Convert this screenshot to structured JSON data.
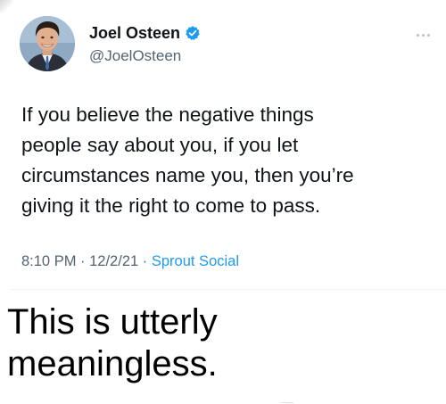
{
  "tweet": {
    "author": {
      "display_name": "Joel Osteen",
      "handle": "@JoelOsteen",
      "verified": true,
      "verified_color": "#1d9bf0"
    },
    "more_icon": "more-horizontal-icon",
    "text": "If you believe the negative things\npeople say about you, if you let\ncircumstances name you, then you’re\ngiving it the right to come to pass.",
    "meta": {
      "time": "8:10 PM",
      "separator_1": " · ",
      "date": "12/2/21",
      "separator_2": " · ",
      "source": "Sprout Social"
    },
    "colors": {
      "text": "#0f1419",
      "secondary": "#536471",
      "link": "#1d9bf0"
    }
  },
  "caption": {
    "text": "This is utterly\nmeaningless."
  }
}
